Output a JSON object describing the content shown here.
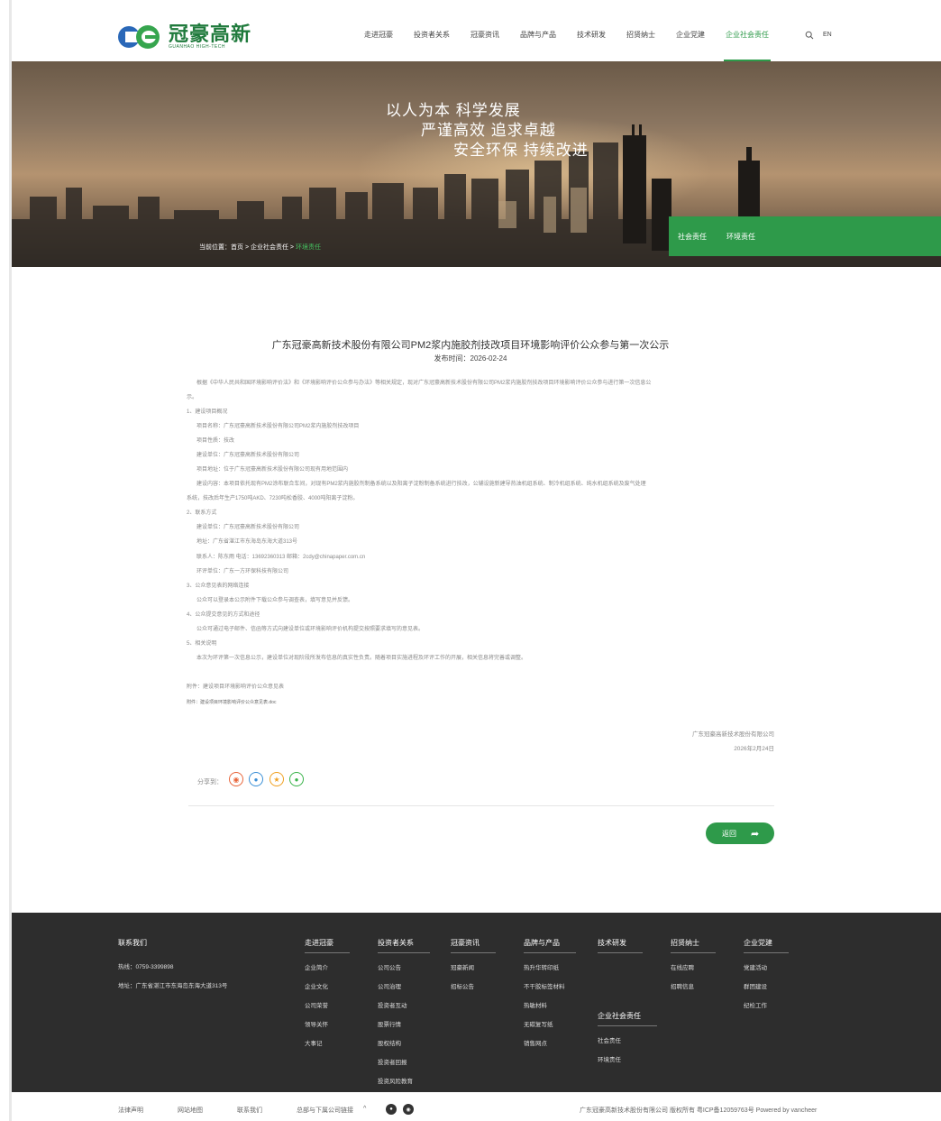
{
  "header": {
    "logo_cn": "冠豪高新",
    "logo_en": "GUANHAO HIGH-TECH",
    "nav": [
      {
        "label": "走进冠豪"
      },
      {
        "label": "投资者关系"
      },
      {
        "label": "冠豪资讯"
      },
      {
        "label": "品牌与产品"
      },
      {
        "label": "技术研发"
      },
      {
        "label": "招贤纳士"
      },
      {
        "label": "企业党建"
      },
      {
        "label": "企业社会责任",
        "active": true
      }
    ],
    "lang": "EN",
    "search_icon": "search-icon"
  },
  "banner": {
    "slogans": [
      "以人为本  科学发展",
      "严谨高效  追求卓越",
      "安全环保  持续改进"
    ],
    "breadcrumb": {
      "prefix": "当前位置：首页 > 企业社会责任 > ",
      "current": "环境责任"
    },
    "tabs": [
      "社会责任",
      "环境责任"
    ]
  },
  "article": {
    "title": "广东冠豪高新技术股份有限公司PM2浆内施胶剂技改项目环境影响评价公众参与第一次公示",
    "date": "发布时间：2026-02-24",
    "lines": [
      "根据《中华人民共和国环境影响评价法》和《环境影响评价公众参与办法》等相关规定，现对广东冠豪高新技术股份有限公司PM2浆内施胶剂技改项目环境影响评价公众参与进行第一次信息公",
      "示。",
      "1、建设项目概况",
      "项目名称：广东冠豪高新技术股份有限公司PM2浆内施胶剂技改项目",
      "项目性质：技改",
      "建设单位：广东冠豪高新技术股份有限公司",
      "项目地址：位于广东冠豪高新技术股份有限公司现有用地范围内",
      "建设内容：本项目依托现有PM2涂布联合车间，对现有PM2浆内施胶剂制备系统以及阳离子淀粉制备系统进行技改，公辅设施新建导热油机组系统、制冷机组系统、纯水机组系统及废气处理",
      "系统，技改后年生产1750吨AKD、7230吨松香胶、4000吨阳离子淀粉。",
      "2、联系方式",
      "建设单位：广东冠豪高新技术股份有限公司",
      "地址：广东省湛江市东海岛东海大道313号",
      "联系人：陈东雨    电话：13692360313    邮箱：2cdy@chinapaper.com.cn",
      "环评单位：广东一方环保科技有限公司",
      "3、公众意见表的网络连接",
      "公众可以登录本公示附件下载公众参与调查表，填写意见并反馈。",
      "4、公众提交意见的方式和途径",
      "公众可通过电子邮件、信函等方式向建设单位或环境影响评价机构提交按照要求填写的意见表。",
      "5、相关说明",
      "本次为环评第一次信息公示，建设单位对现阶段所发布信息的真实性负责。随着项目实施进程及环评工作的开展，相关信息将完善或调整。",
      "附件：建设项目环境影响评价公众意见表",
      "附件：建设项目环境影响评价公众意见表.doc"
    ],
    "signature": {
      "company": "广东冠豪高新技术股份有限公司",
      "date": "2026年2月24日"
    },
    "share_label": "分享到：",
    "share_icons": [
      "weibo-icon",
      "qq-icon",
      "qzone-icon",
      "wechat-icon"
    ],
    "back_label": "返回"
  },
  "footer": {
    "contact": {
      "title": "联系我们",
      "hotline": "热线：0759-3399898",
      "address": "地址：广东省湛江市东海岛东海大道313号"
    },
    "columns": [
      {
        "title": "走进冠豪",
        "items": [
          "企业简介",
          "企业文化",
          "公司荣誉",
          "领导关怀",
          "大事记"
        ]
      },
      {
        "title": "投资者关系",
        "items": [
          "公司公告",
          "公司治理",
          "投资者互动",
          "股票行情",
          "股权结构",
          "投资者回报",
          "投资风险教育"
        ]
      },
      {
        "title": "冠豪资讯",
        "items": [
          "冠豪新闻",
          "招标公告"
        ]
      },
      {
        "title": "品牌与产品",
        "items": [
          "热升华转印纸",
          "不干胶标签材料",
          "热敏材料",
          "无碳复写纸",
          "销售网点"
        ]
      },
      {
        "title": "技术研发",
        "items": []
      },
      {
        "title": "招贤纳士",
        "items": [
          "在线应聘",
          "招聘信息"
        ]
      },
      {
        "title": "企业党建",
        "items": [
          "党建活动",
          "群团建设",
          "纪检工作"
        ]
      }
    ],
    "csr": {
      "title": "企业社会责任",
      "items": [
        "社会责任",
        "环境责任"
      ]
    }
  },
  "bottom": {
    "links": [
      "法律声明",
      "网站地图",
      "联系我们",
      "总部与下属公司链接"
    ],
    "caret": "^",
    "copyright": "广东冠豪高新技术股份有限公司 版权所有 粤ICP备12059763号 Powered by vancheer"
  },
  "colors": {
    "brand_green": "#2e9a4a",
    "footer_bg": "#2d2d2d"
  }
}
